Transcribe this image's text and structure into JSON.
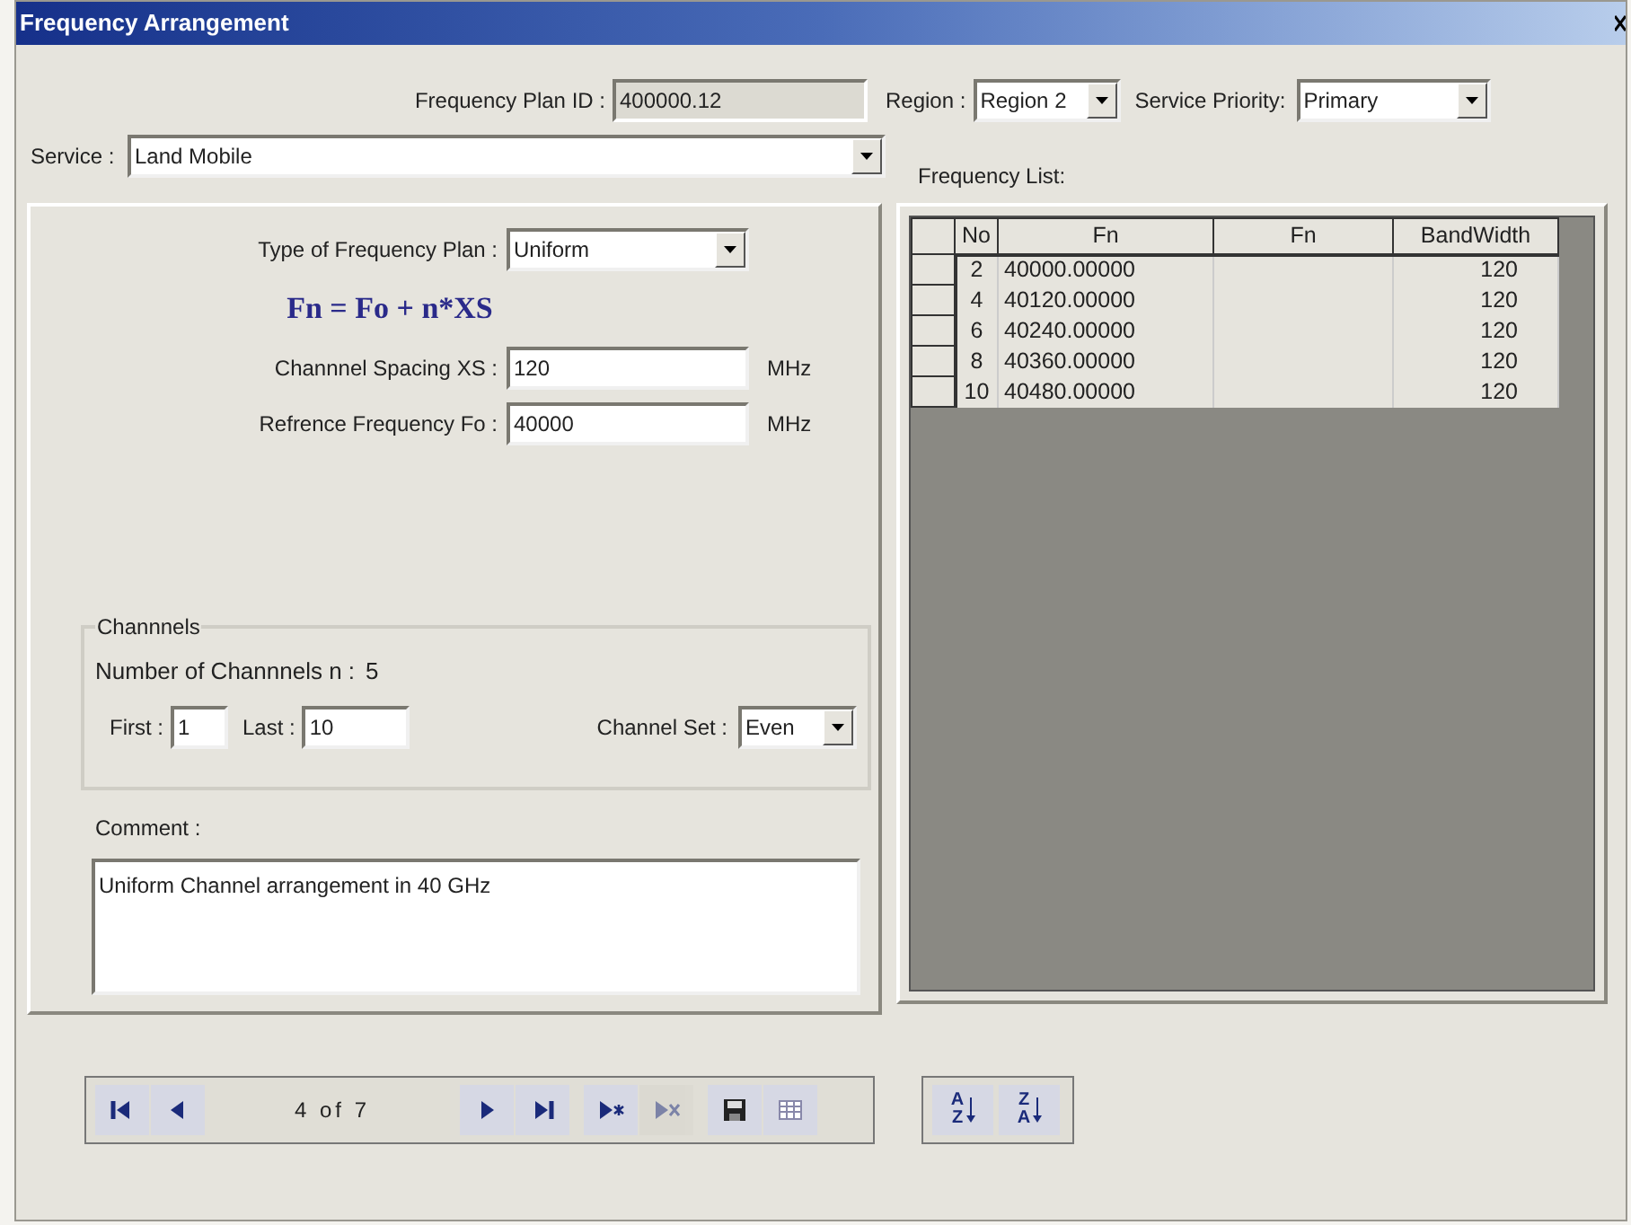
{
  "window": {
    "title": "Frequency Arrangement"
  },
  "plan_id": {
    "label": "Frequency Plan ID :",
    "value": "400000.12",
    "disabled": true
  },
  "region": {
    "label": "Region :",
    "value": "Region 2"
  },
  "service_priority": {
    "label": "Service Priority:",
    "value": "Primary"
  },
  "service": {
    "label": "Service :",
    "value": "Land Mobile"
  },
  "plan_type": {
    "label": "Type of Frequency Plan :",
    "value": "Uniform"
  },
  "formula": "Fn = Fo + n*XS",
  "spacing": {
    "label": "Channnel Spacing  XS :",
    "value": "120",
    "unit": "MHz"
  },
  "reference": {
    "label": "Refrence Frequency  Fo :",
    "value": "40000",
    "unit": "MHz"
  },
  "channels": {
    "legend": "Channnels",
    "count_label": "Number of Channnels  n :",
    "count": "5",
    "first_label": "First :",
    "first": "1",
    "last_label": "Last :",
    "last": "10",
    "set_label": "Channel Set :",
    "set": "Even"
  },
  "comment": {
    "label": "Comment :",
    "value": "Uniform Channel arrangement in 40 GHz"
  },
  "frequency_list": {
    "label": "Frequency List:",
    "columns": [
      "No",
      "Fn",
      "Fn",
      "BandWidth"
    ],
    "rows": [
      [
        "2",
        "40000.00000",
        "",
        "120"
      ],
      [
        "4",
        "40120.00000",
        "",
        "120"
      ],
      [
        "6",
        "40240.00000",
        "",
        "120"
      ],
      [
        "8",
        "40360.00000",
        "",
        "120"
      ],
      [
        "10",
        "40480.00000",
        "",
        "120"
      ]
    ]
  },
  "navigator": {
    "position": "4 of 7",
    "buttons": [
      {
        "kind": "first",
        "disabled": false
      },
      {
        "kind": "prev",
        "disabled": false
      },
      {
        "kind": "next",
        "disabled": false
      },
      {
        "kind": "last",
        "disabled": false
      },
      {
        "kind": "add",
        "disabled": false
      },
      {
        "kind": "delete",
        "disabled": true
      },
      {
        "kind": "save",
        "disabled": false
      },
      {
        "kind": "grid",
        "disabled": false
      }
    ]
  },
  "sort_buttons": [
    {
      "top": "A",
      "bottom": "Z"
    },
    {
      "top": "Z",
      "bottom": "A"
    }
  ]
}
